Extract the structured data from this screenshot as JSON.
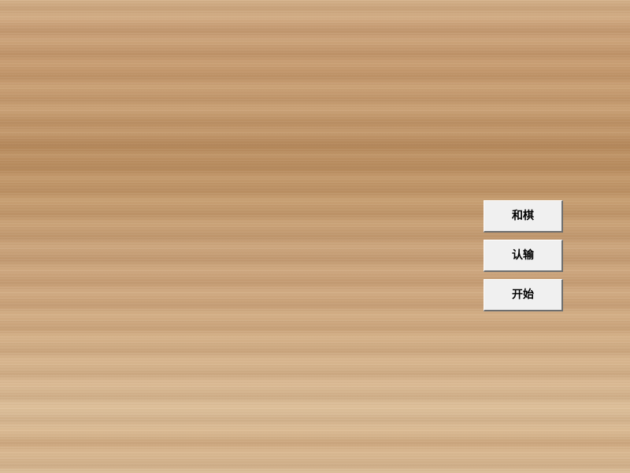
{
  "buttons": {
    "draw": "和棋",
    "resign": "认输",
    "start": "开始"
  },
  "colors": {
    "button_face": "#f0f0f0",
    "wood_light": "#dcbf9b",
    "wood_dark": "#b98d60"
  }
}
